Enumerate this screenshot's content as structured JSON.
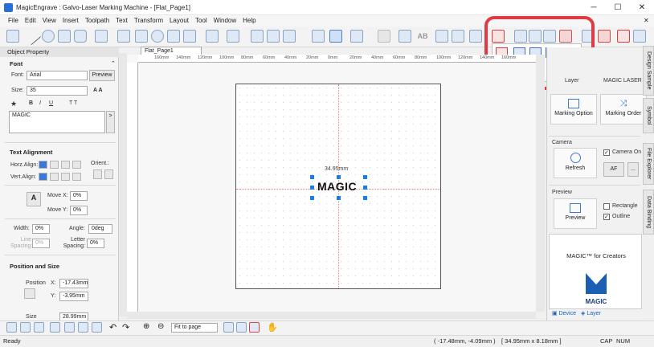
{
  "window": {
    "title": "MagicEngrave : Galvo-Laser Marking Machine - [Flat_Page1]"
  },
  "menu": [
    "File",
    "Edit",
    "View",
    "Insert",
    "Toolpath",
    "Text",
    "Transform",
    "Layout",
    "Tool",
    "Window",
    "Help"
  ],
  "left_panel": {
    "header": "Object Property",
    "font_section": "Font",
    "font_label": "Font:",
    "font_value": "Arial",
    "preview_label": "Preview",
    "size_label": "Size:",
    "size_value": "35",
    "text_value": "MAGIC",
    "align_section": "Text Alignment",
    "horz_label": "Horz.Align:",
    "vert_label": "Vert.Align:",
    "orient_label": "Orient.:",
    "movex_label": "Move X:",
    "movex_value": "0%",
    "movey_label": "Move Y:",
    "movey_value": "0%",
    "width_label": "Width:",
    "width_value": "0%",
    "angle_label": "Angle:",
    "angle_value": "0deg",
    "linespacing_label": "Line Spacing:",
    "linespacing_value": "0%",
    "letterspacing_label": "Letter Spacing:",
    "letterspacing_value": "0%",
    "possize_section": "Position and Size",
    "position_label": "Position",
    "x_label": "X:",
    "x_value": "-17.43mm",
    "y_label": "Y:",
    "y_value": "-3.95mm",
    "size2_label": "Size",
    "size_w_value": "28.99mm"
  },
  "document_tab": "Flat_Page1",
  "canvas": {
    "object_text": "MAGIC",
    "dimension_label": "34.95mm"
  },
  "right_panel": {
    "layer_label": "Layer",
    "laser_label": "MAGIC LASER",
    "marking_option": "Marking Option",
    "marking_order": "Marking Order",
    "camera_section": "Camera",
    "refresh": "Refresh",
    "camera_on": "Camera On",
    "af": "AF",
    "more": "...",
    "preview_section": "Preview",
    "preview_btn": "Preview",
    "rectangle": "Rectangle",
    "outline": "Outline",
    "promo": "MAGIC™ for Creators",
    "brand": "MAGIC",
    "device_tab": "Device",
    "layer_tab": "Layer"
  },
  "side_tabs": [
    "Design Sample",
    "Symbol",
    "File Explorer",
    "Data Binding"
  ],
  "bottom": {
    "zoom_option": "Fit to page"
  },
  "status": {
    "ready": "Ready",
    "coords": "( -17.48mm, -4.09mm )",
    "size": "[ 34.95mm x 8.18mm ]",
    "caps": "CAP",
    "num": "NUM"
  },
  "ruler_ticks": [
    "160mm",
    "140mm",
    "120mm",
    "100mm",
    "80mm",
    "60mm",
    "40mm",
    "20mm",
    "0mm",
    "20mm",
    "40mm",
    "60mm",
    "80mm",
    "100mm",
    "120mm",
    "140mm",
    "160mm"
  ],
  "colors": {
    "accent": "#1e7ae6",
    "highlight": "#e03a44"
  }
}
